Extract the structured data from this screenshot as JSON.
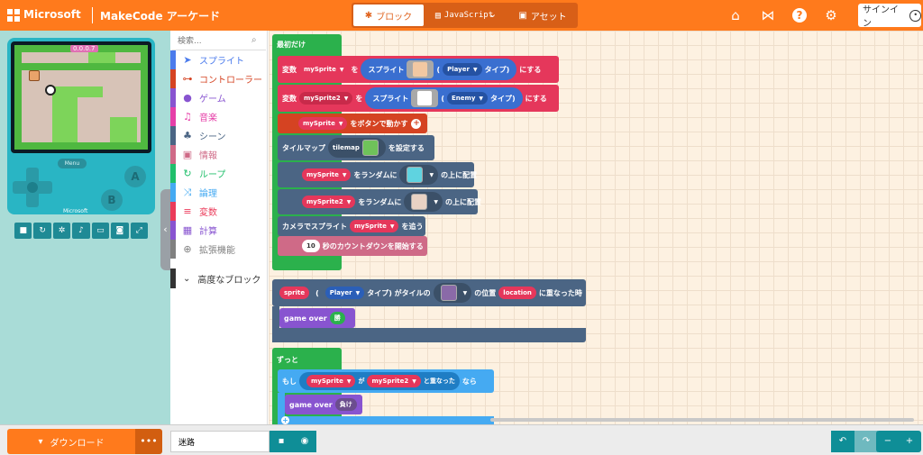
{
  "header": {
    "brand": "Microsoft",
    "product": "MakeCode アーケード",
    "tabs": {
      "blocks": "ブロック",
      "javascript": "JavaScript",
      "assets": "アセット"
    },
    "signin": "サインイン",
    "icons": [
      "home-icon",
      "share-icon",
      "help-icon",
      "gear-icon",
      "user-icon"
    ],
    "accent_color": "#ff7a1c"
  },
  "simulator": {
    "screen_countdown": "0.0.0.7",
    "menu_label": "Menu",
    "a_label": "A",
    "b_label": "B",
    "console_brand": "Microsoft",
    "toolbar_icons": [
      "stop-icon",
      "restart-icon",
      "debug-icon",
      "sound-icon",
      "keyboard-icon",
      "screenshot-icon",
      "fullscreen-icon"
    ]
  },
  "toolbox": {
    "search_placeholder": "検索...",
    "categories": [
      {
        "label": "スプライト",
        "color": "#4b7bec",
        "icon": "paper-plane-icon"
      },
      {
        "label": "コントローラー",
        "color": "#d54322",
        "icon": "gamepad-icon"
      },
      {
        "label": "ゲーム",
        "color": "#8854d0",
        "icon": "circle-icon"
      },
      {
        "label": "音楽",
        "color": "#e63fa8",
        "icon": "headphones-icon"
      },
      {
        "label": "シーン",
        "color": "#4b6584",
        "icon": "tree-icon"
      },
      {
        "label": "情報",
        "color": "#cf6a87",
        "icon": "id-card-icon"
      },
      {
        "label": "ループ",
        "color": "#20bf6b",
        "icon": "loop-icon"
      },
      {
        "label": "論理",
        "color": "#45aaf2",
        "icon": "shuffle-icon"
      },
      {
        "label": "変数",
        "color": "#eb3b5a",
        "icon": "list-icon"
      },
      {
        "label": "計算",
        "color": "#8854d0",
        "icon": "calculator-icon"
      },
      {
        "label": "拡張機能",
        "color": "#808080",
        "icon": "plus-icon"
      }
    ],
    "advanced": "高度なブロック"
  },
  "workspace": {
    "on_start": "最初だけ",
    "set_var1": {
      "prefix": "変数",
      "var": "mySprite",
      "mid": "を",
      "sprite": "スプライト",
      "open": "(",
      "kind": "Player",
      "suffix": "タイプ)",
      "end": "にする"
    },
    "set_var2": {
      "prefix": "変数",
      "var": "mySprite2",
      "mid": "を",
      "sprite": "スプライト",
      "open": "(",
      "kind": "Enemy",
      "suffix": "タイプ)",
      "end": "にする"
    },
    "move_buttons": {
      "var": "mySprite",
      "text": "をボタンで動かす"
    },
    "tilemap": {
      "prefix": "タイルマップ",
      "name": "tilemap",
      "suffix": "を設定する"
    },
    "random1": {
      "var": "mySprite",
      "mid": "をランダムに",
      "end": "の上に配置"
    },
    "random2": {
      "var": "mySprite2",
      "mid": "をランダムに",
      "end": "の上に配置"
    },
    "camera": {
      "prefix": "カメラでスプライト",
      "var": "mySprite",
      "suffix": "を追う"
    },
    "countdown": {
      "value": "10",
      "text": "秒のカウントダウンを開始する"
    },
    "overlap_tile": {
      "sprite": "sprite",
      "open": "(",
      "kind": "Player",
      "mid": "タイプ) がタイルの",
      "pos": "の位置",
      "loc": "location",
      "end": "に重なった時"
    },
    "game_over1": {
      "label": "game over",
      "value": "勝"
    },
    "forever": "ずっと",
    "if_block": {
      "if": "もし",
      "var1": "mySprite",
      "ga": "が",
      "var2": "mySprite2",
      "overlap": "と重なった",
      "then": "なら"
    },
    "game_over2": {
      "label": "game over",
      "value": "負け"
    }
  },
  "footer": {
    "download": "ダウンロード",
    "more": "•••",
    "project_name": "迷路",
    "icons": [
      "save-icon",
      "github-icon",
      "undo-icon",
      "redo-icon",
      "zoom-out-icon",
      "zoom-in-icon"
    ]
  }
}
